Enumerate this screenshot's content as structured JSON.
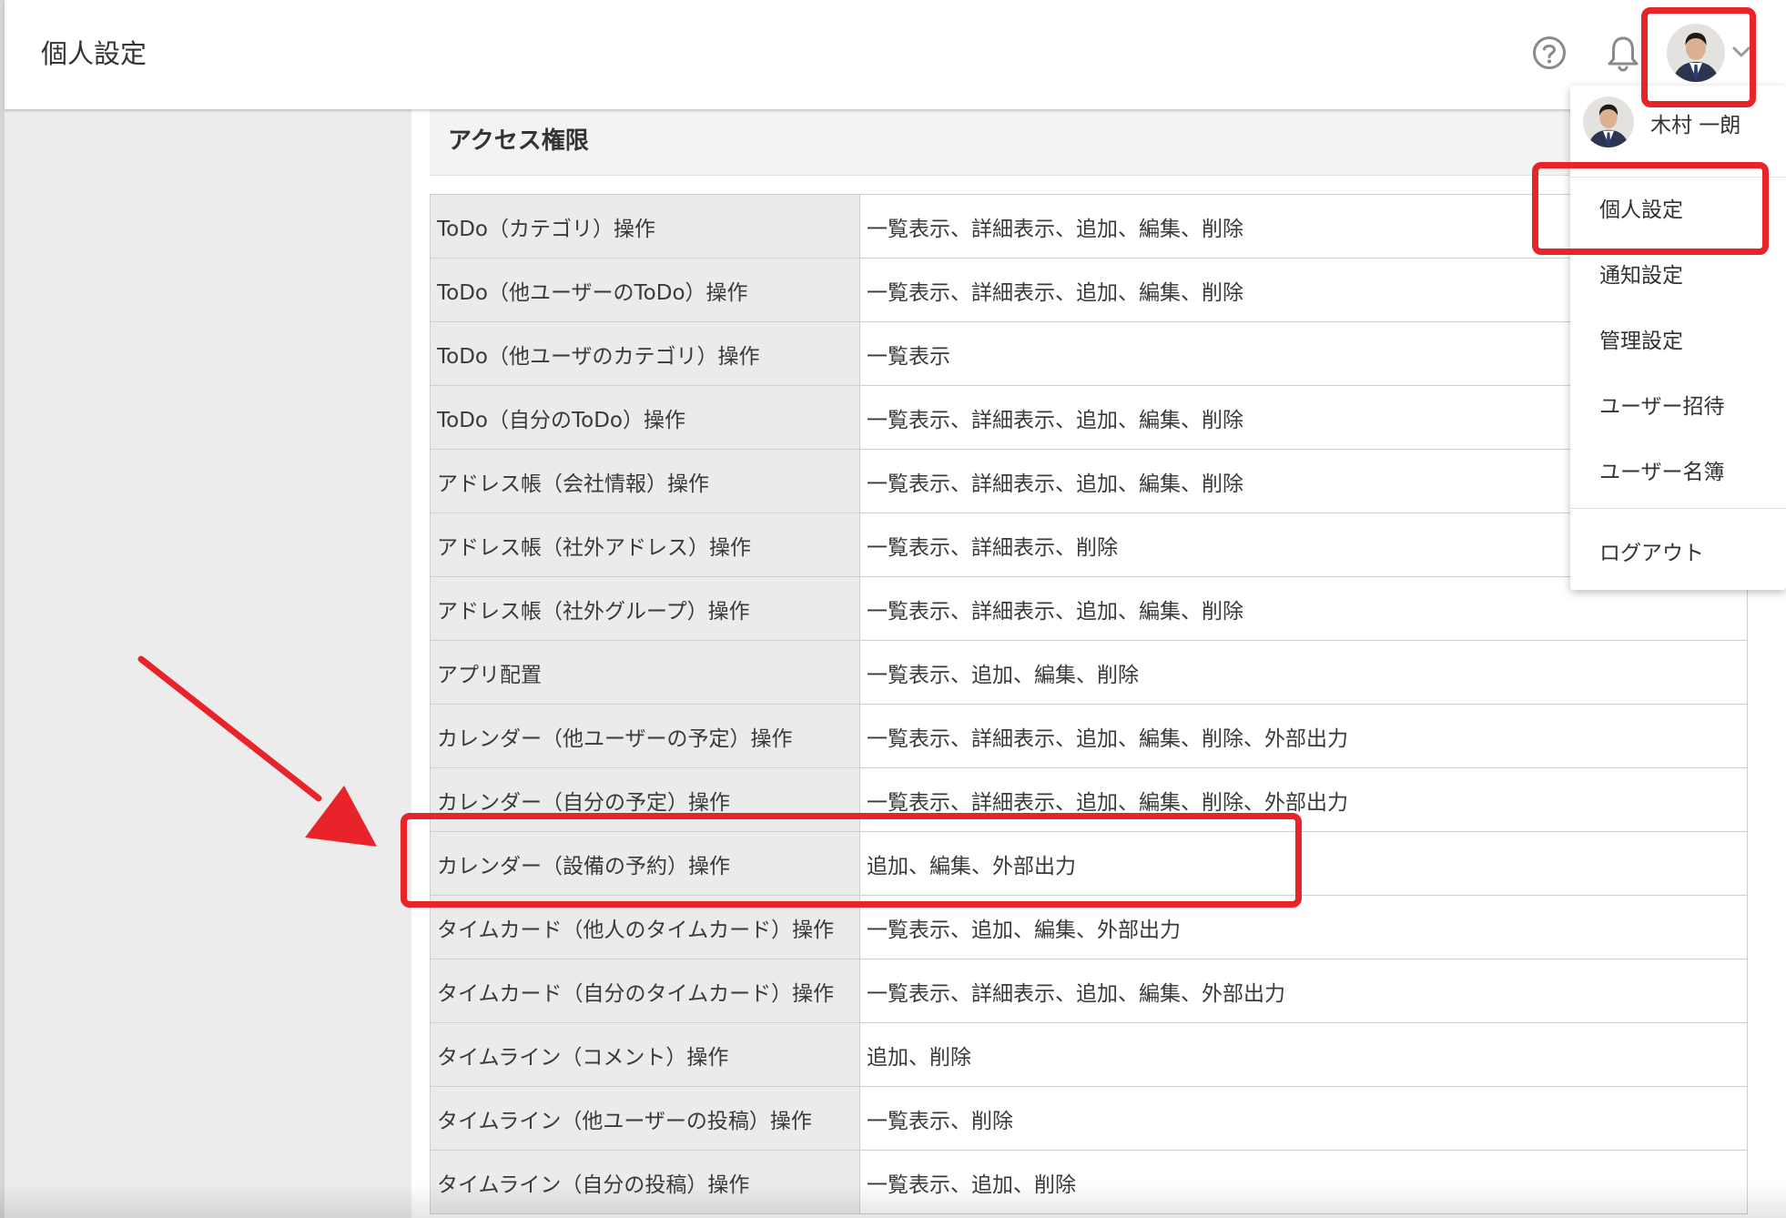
{
  "header": {
    "page_title": "個人設定",
    "help_icon": "question-circle-icon",
    "notification_icon": "bell-icon",
    "menu_toggle_icon": "chevron-down-icon"
  },
  "section": {
    "title": "アクセス権限"
  },
  "permissions": [
    {
      "name": "ToDo（カテゴリ）操作",
      "value": "一覧表示、詳細表示、追加、編集、削除"
    },
    {
      "name": "ToDo（他ユーザーのToDo）操作",
      "value": "一覧表示、詳細表示、追加、編集、削除"
    },
    {
      "name": "ToDo（他ユーザのカテゴリ）操作",
      "value": "一覧表示"
    },
    {
      "name": "ToDo（自分のToDo）操作",
      "value": "一覧表示、詳細表示、追加、編集、削除"
    },
    {
      "name": "アドレス帳（会社情報）操作",
      "value": "一覧表示、詳細表示、追加、編集、削除"
    },
    {
      "name": "アドレス帳（社外アドレス）操作",
      "value": "一覧表示、詳細表示、削除"
    },
    {
      "name": "アドレス帳（社外グループ）操作",
      "value": "一覧表示、詳細表示、追加、編集、削除"
    },
    {
      "name": "アプリ配置",
      "value": "一覧表示、追加、編集、削除"
    },
    {
      "name": "カレンダー（他ユーザーの予定）操作",
      "value": "一覧表示、詳細表示、追加、編集、削除、外部出力"
    },
    {
      "name": "カレンダー（自分の予定）操作",
      "value": "一覧表示、詳細表示、追加、編集、削除、外部出力"
    },
    {
      "name": "カレンダー（設備の予約）操作",
      "value": "追加、編集、外部出力"
    },
    {
      "name": "タイムカード（他人のタイムカード）操作",
      "value": "一覧表示、追加、編集、外部出力"
    },
    {
      "name": "タイムカード（自分のタイムカード）操作",
      "value": "一覧表示、詳細表示、追加、編集、外部出力"
    },
    {
      "name": "タイムライン（コメント）操作",
      "value": "追加、削除"
    },
    {
      "name": "タイムライン（他ユーザーの投稿）操作",
      "value": "一覧表示、削除"
    },
    {
      "name": "タイムライン（自分の投稿）操作",
      "value": "一覧表示、追加、削除"
    }
  ],
  "user_menu": {
    "user_name": "木村 一朗",
    "items": [
      "個人設定",
      "通知設定",
      "管理設定",
      "ユーザー招待",
      "ユーザー名簿"
    ],
    "logout": "ログアウト"
  },
  "annotation": {
    "highlight_color": "#e8242a",
    "arrow_color": "#e8242a"
  }
}
